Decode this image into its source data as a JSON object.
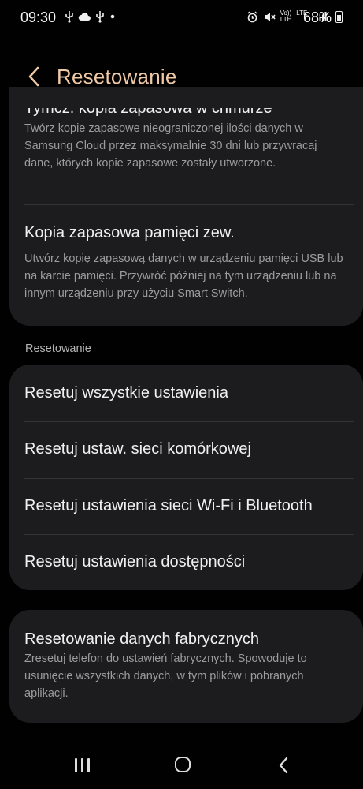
{
  "status_bar": {
    "time": "09:30",
    "left_icons": [
      "usb-icon",
      "cloud-icon",
      "usb-icon",
      "dot-icon"
    ],
    "right_icons": [
      "alarm-icon",
      "mute-icon",
      "volte-lte-icon",
      "lte-plus-icon",
      "signal-icon"
    ],
    "volte": "Vo))",
    "volte_sub": "LTE",
    "lte_plus": "LTE+",
    "battery": "68%"
  },
  "header": {
    "title": "Resetowanie"
  },
  "backup": {
    "cloud_title": "Tymcz. kopia zapasowa w chmurze",
    "cloud_desc": "Twórz kopie zapasowe nieograniczonej ilości danych w Samsung Cloud przez maksymalnie 30 dni lub przywracaj dane, których kopie zapasowe zostały utworzone.",
    "external_title": "Kopia zapasowa pamięci zew.",
    "external_desc": "Utwórz kopię zapasową danych w urządzeniu pamięci USB lub na karcie pamięci. Przywróć później na tym urządzeniu lub na innym urządzeniu przy użyciu Smart Switch."
  },
  "reset_section": {
    "label": "Resetowanie",
    "items": [
      "Resetuj wszystkie ustawienia",
      "Resetuj ustaw. sieci komórkowej",
      "Resetuj ustawienia sieci Wi-Fi i Bluetooth",
      "Resetuj ustawienia dostępności"
    ]
  },
  "factory": {
    "title": "Resetowanie danych fabrycznych",
    "desc": "Zresetuj telefon do ustawień fabrycznych. Spowoduje to usunięcie wszystkich danych, w tym plików i pobranych aplikacji."
  },
  "colors": {
    "background": "#010101",
    "card": "#1c1c1e",
    "accent": "#efc8a6",
    "secondary_text": "#9c9c9c"
  }
}
